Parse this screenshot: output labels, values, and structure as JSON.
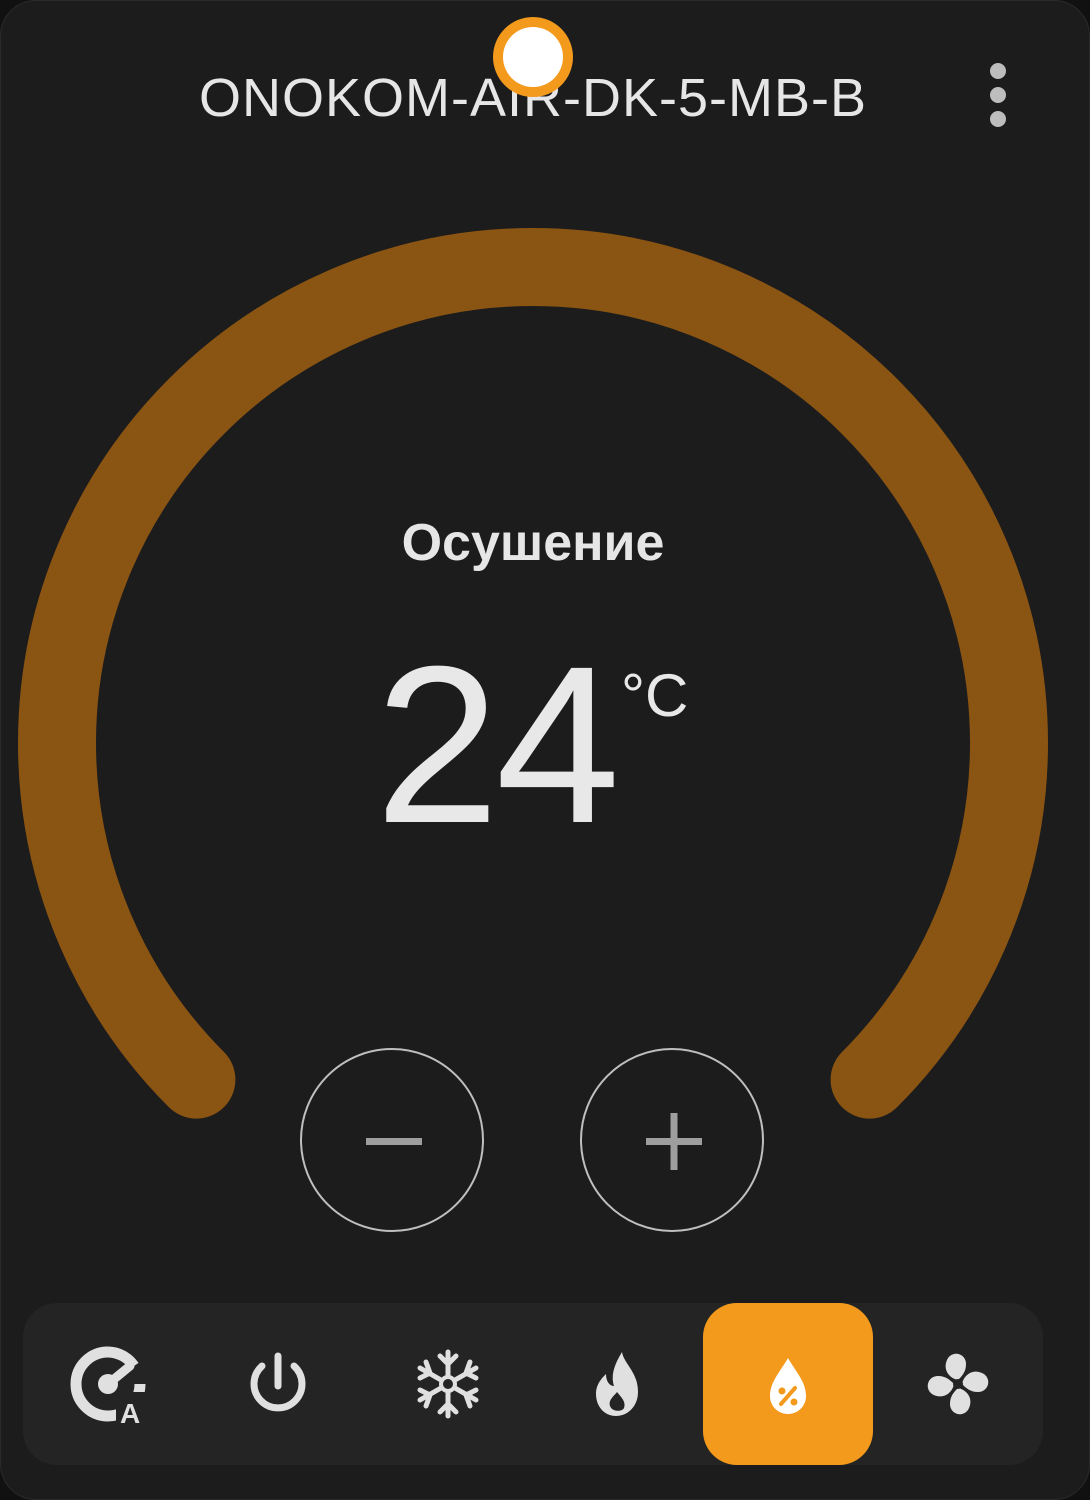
{
  "device": {
    "name": "ONOKOM-AIR-DK-5-MB-B"
  },
  "thermostat": {
    "mode_label": "Осушение",
    "target_temperature": "24",
    "unit": "°C",
    "arc_color": "#8a5413",
    "knob_color": "#f39a1d",
    "setpoint_fraction": 0.5
  },
  "modes": [
    {
      "icon": "auto-mode-icon",
      "active": false
    },
    {
      "icon": "power-icon",
      "active": false
    },
    {
      "icon": "snowflake-icon",
      "active": false
    },
    {
      "icon": "fire-icon",
      "active": false
    },
    {
      "icon": "humidity-drop-icon",
      "active": true
    },
    {
      "icon": "fan-icon",
      "active": false
    }
  ],
  "colors": {
    "background": "#1c1c1c",
    "accent": "#f39a1d",
    "icon": "#e0e0e0"
  }
}
